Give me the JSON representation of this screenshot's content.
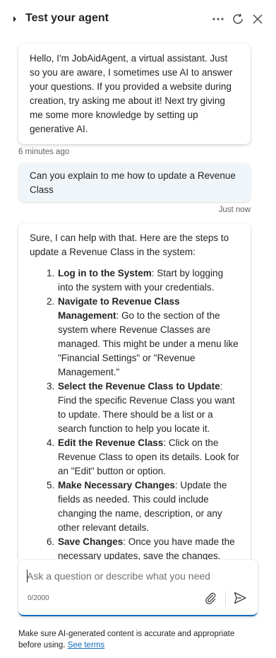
{
  "header": {
    "title": "Test your agent"
  },
  "messages": [
    {
      "role": "agent",
      "text": "Hello, I'm JobAidAgent, a virtual assistant. Just so you are aware, I sometimes use AI to answer your questions. If you provided a website during creation, try asking me about it! Next try giving me some more knowledge by setting up generative AI.",
      "timestamp": "6 minutes ago"
    },
    {
      "role": "user",
      "text": "Can you explain to me how to update a Revenue Class",
      "timestamp": "Just now"
    },
    {
      "role": "agent",
      "intro": "Sure, I can help with that. Here are the steps to update a Revenue Class in the system:",
      "steps": [
        {
          "num": "1.",
          "title": "Log in to the System",
          "text": ": Start by logging into the system with your credentials."
        },
        {
          "num": "2.",
          "title": "Navigate to Revenue Class Management",
          "text": ": Go to the section of the system where Revenue Classes are managed. This might be under a menu like \"Financial Settings\" or \"Revenue Management.\""
        },
        {
          "num": "3.",
          "title": "Select the Revenue Class to Update",
          "text": ": Find the specific Revenue Class you want to update. There should be a list or a search function to help you locate it."
        },
        {
          "num": "4.",
          "title": "Edit the Revenue Class",
          "text": ": Click on the Revenue Class to open its details. Look for an \"Edit\" button or option."
        },
        {
          "num": "5.",
          "title": "Make Necessary Changes",
          "text": ": Update the fields as needed. This could include changing the name, description, or any other relevant details."
        },
        {
          "num": "6.",
          "title": "Save Changes",
          "text": ": Once you have made the necessary updates, save the changes."
        }
      ]
    }
  ],
  "composer": {
    "placeholder": "Ask a question or describe what you need",
    "counter": "0/2000"
  },
  "footer": {
    "disclaimer": "Make sure AI-generated content is accurate and appropriate before using.",
    "link": "See terms"
  },
  "colors": {
    "accent": "#0f6cbd",
    "user_bubble": "#f0f5f9"
  }
}
